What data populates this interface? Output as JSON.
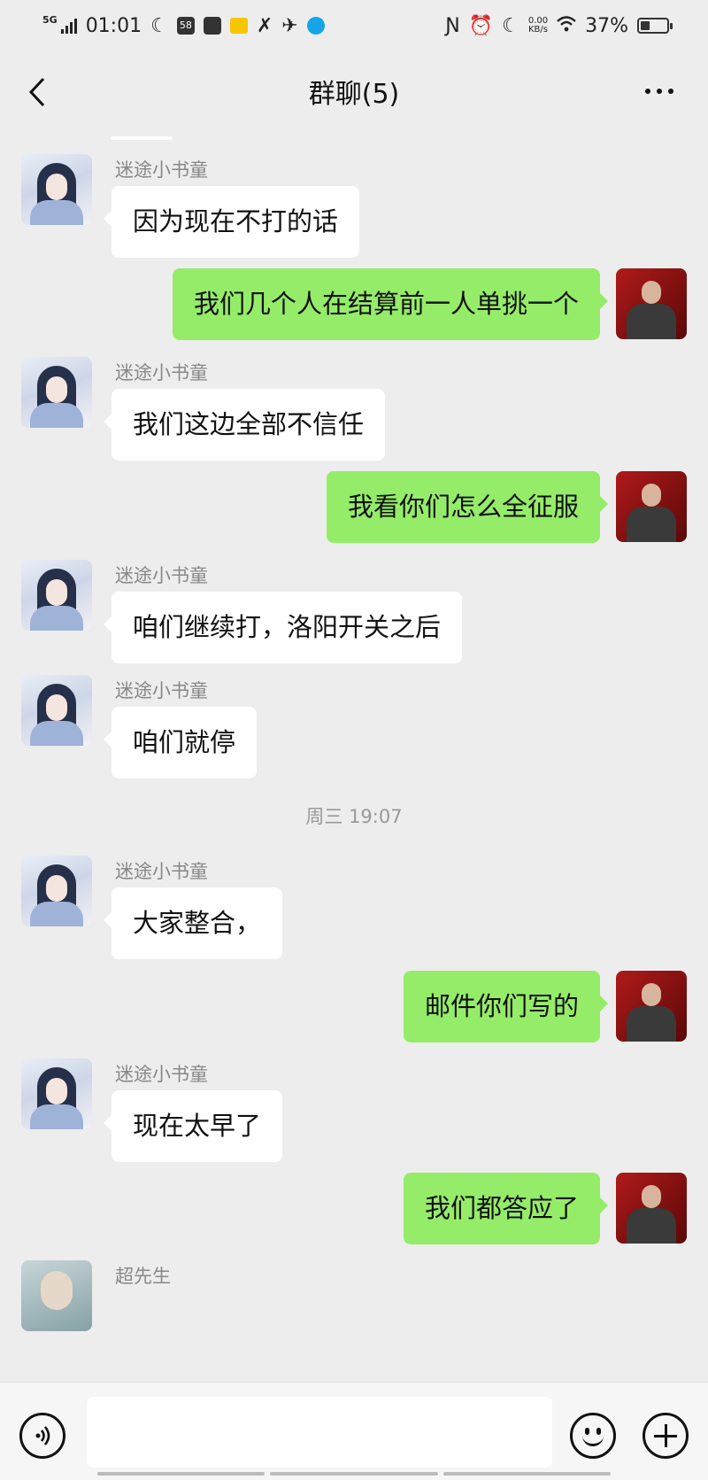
{
  "status_bar": {
    "network": "5G",
    "time": "01:01",
    "notif_badge": "58",
    "net_speed_value": "0.00",
    "net_speed_unit": "KB/s",
    "battery_percent": "37%",
    "battery_level": 0.37
  },
  "header": {
    "title": "群聊(5)"
  },
  "messages": [
    {
      "side": "left",
      "sender": "迷途小书童",
      "text": "因为现在不打的话"
    },
    {
      "side": "right",
      "text": "我们几个人在结算前一人单挑一个"
    },
    {
      "side": "left",
      "sender": "迷途小书童",
      "text": "我们这边全部不信任"
    },
    {
      "side": "right",
      "text": "我看你们怎么全征服"
    },
    {
      "side": "left",
      "sender": "迷途小书童",
      "text": "咱们继续打，洛阳开关之后"
    },
    {
      "side": "left",
      "sender": "迷途小书童",
      "text": "咱们就停"
    },
    {
      "type": "timestamp",
      "text": "周三 19:07"
    },
    {
      "side": "left",
      "sender": "迷途小书童",
      "text": "大家整合，"
    },
    {
      "side": "right",
      "text": "邮件你们写的"
    },
    {
      "side": "left",
      "sender": "迷途小书童",
      "text": "现在太早了"
    },
    {
      "side": "right",
      "text": "我们都答应了"
    },
    {
      "side": "left",
      "sender": "超先生",
      "text": ""
    }
  ],
  "colors": {
    "background": "#ededed",
    "outgoing_bubble": "#95ec69",
    "incoming_bubble": "#ffffff"
  }
}
